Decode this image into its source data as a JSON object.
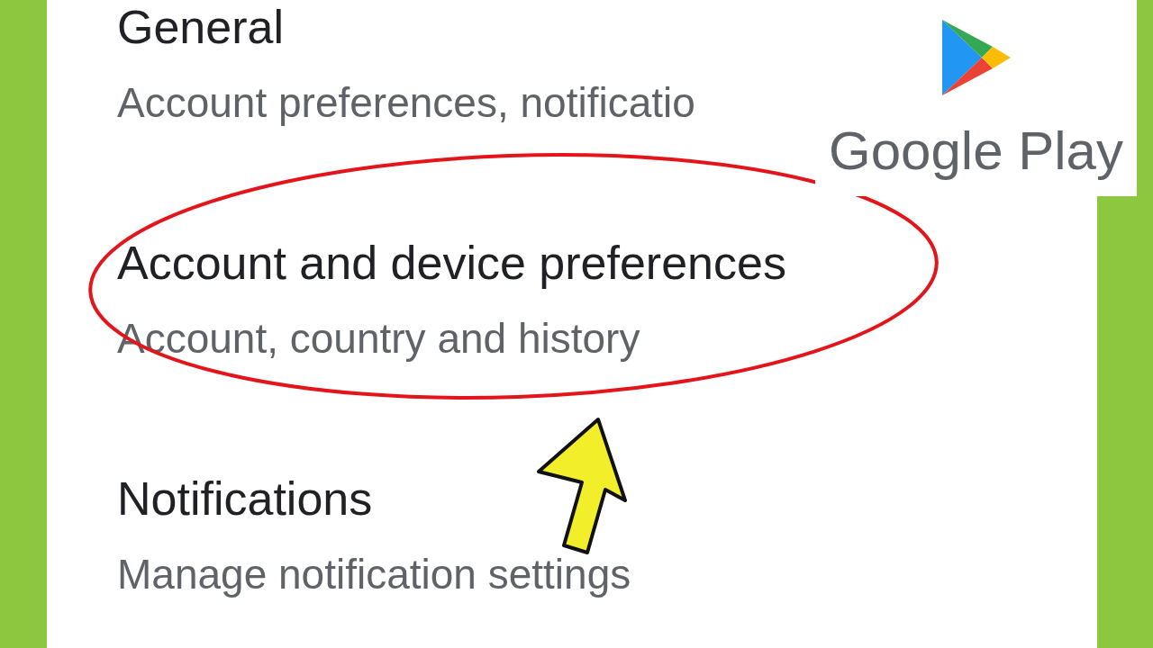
{
  "settings": [
    {
      "title": "General",
      "subtitle": "Account preferences, notificatio",
      "highlighted": false
    },
    {
      "title": "Account and device preferences",
      "subtitle": "Account, country and history",
      "highlighted": true
    },
    {
      "title": "Notifications",
      "subtitle": "Manage notification settings",
      "highlighted": false
    }
  ],
  "logo": {
    "text": "Google Play"
  },
  "pointer": {
    "kind": "arrow"
  }
}
